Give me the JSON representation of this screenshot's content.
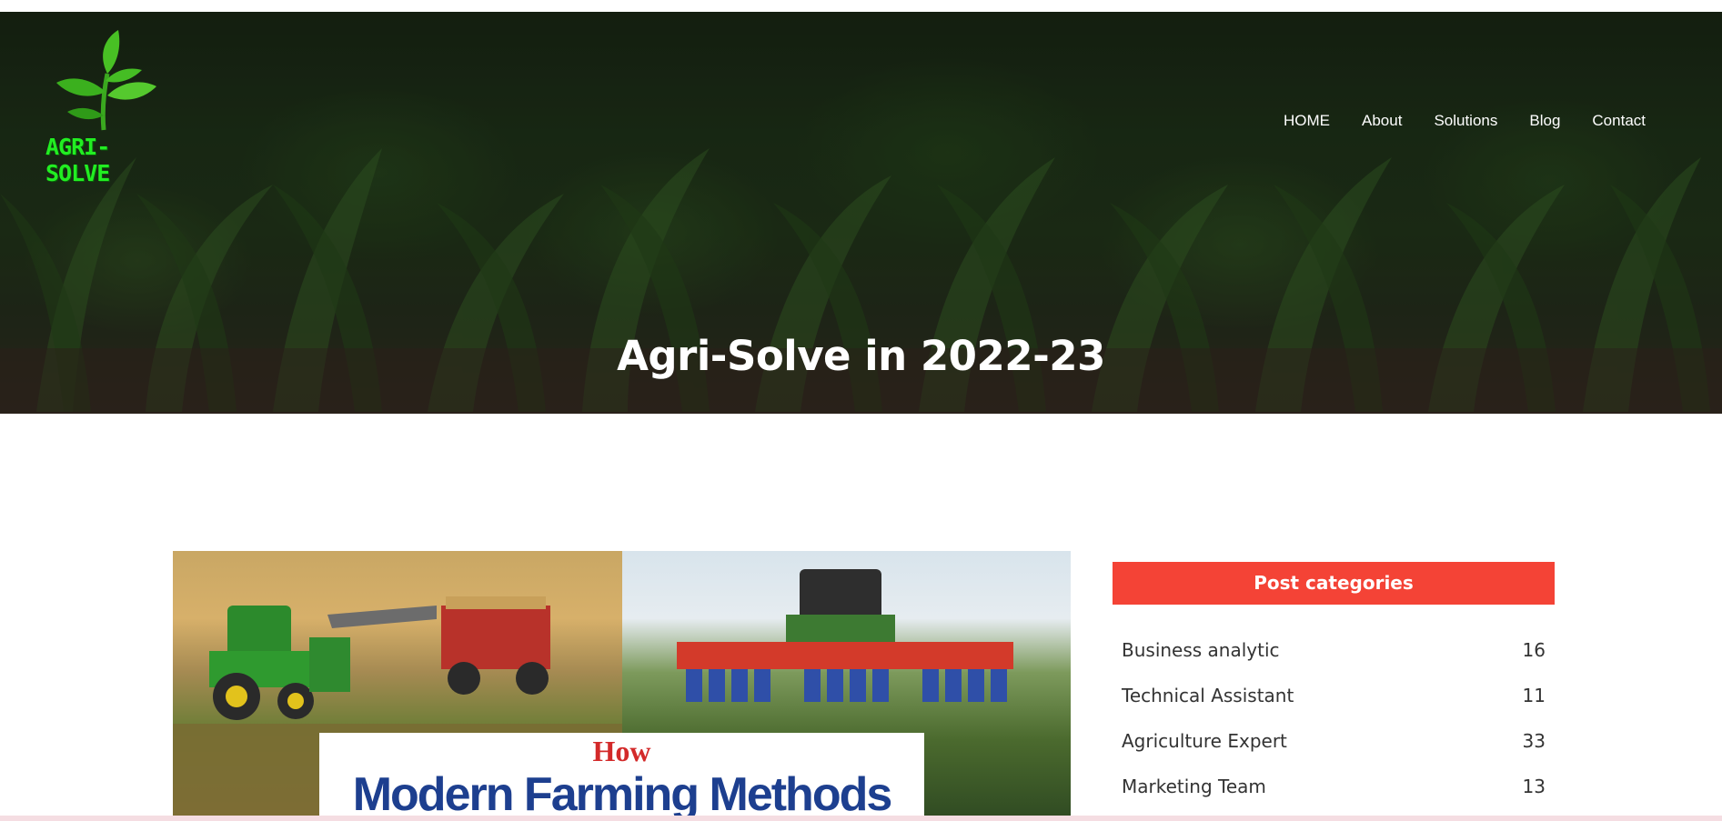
{
  "brand": {
    "logo_text": "AGRI-SOLVE",
    "logo_icon": "sprout-icon"
  },
  "nav": {
    "items": [
      {
        "label": "HOME"
      },
      {
        "label": "About"
      },
      {
        "label": "Solutions"
      },
      {
        "label": "Blog"
      },
      {
        "label": "Contact"
      }
    ]
  },
  "hero": {
    "title": "Agri-Solve in 2022-23"
  },
  "post": {
    "image_caption_how": "How",
    "image_caption_main": "Modern Farming Methods"
  },
  "sidebar": {
    "header": "Post categories",
    "categories": [
      {
        "name": "Business analytic",
        "count": "16"
      },
      {
        "name": "Technical Assistant",
        "count": "11"
      },
      {
        "name": "Agriculture Expert",
        "count": "33"
      },
      {
        "name": "Marketing Team",
        "count": "13"
      }
    ]
  },
  "colors": {
    "accent": "#f44336",
    "logo_green": "#22ee22",
    "caption_blue": "#1d3f8f",
    "caption_red": "#d32a2a"
  }
}
